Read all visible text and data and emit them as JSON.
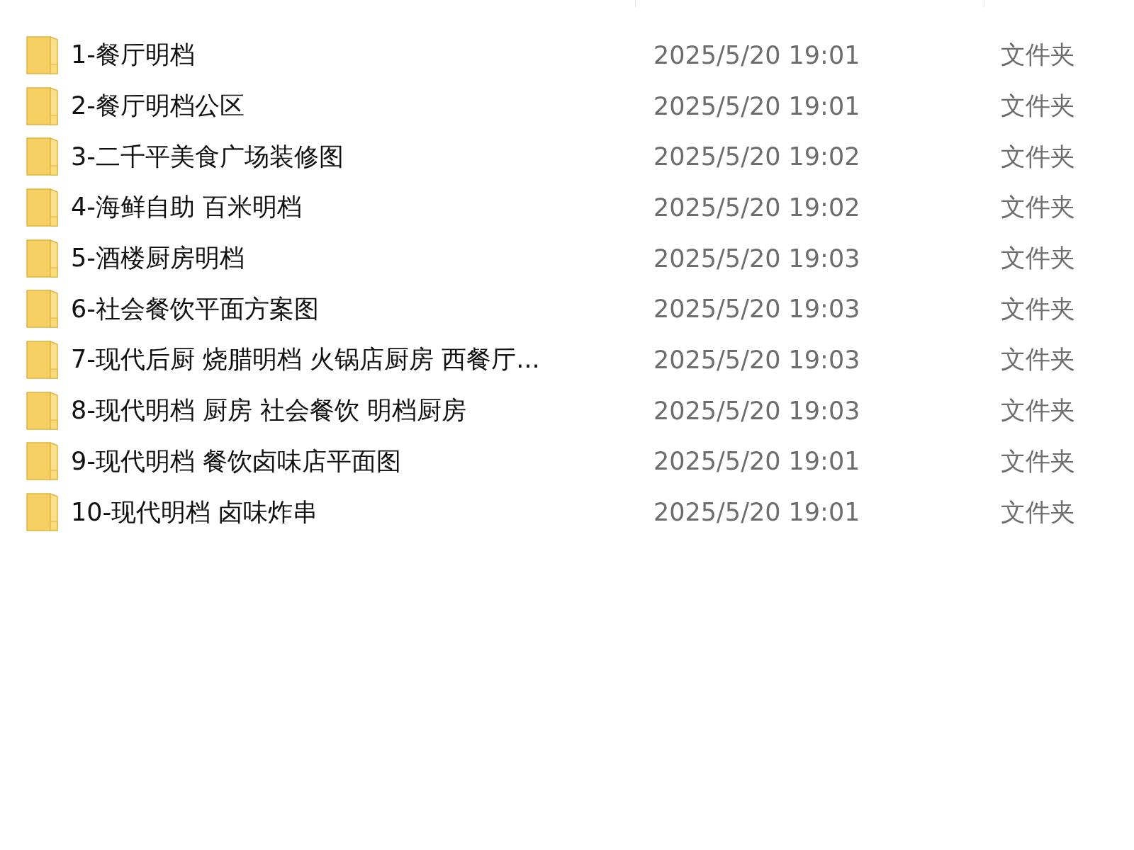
{
  "files": [
    {
      "name": "1-餐厅明档",
      "modified": "2025/5/20 19:01",
      "type": "文件夹"
    },
    {
      "name": "2-餐厅明档公区",
      "modified": "2025/5/20 19:01",
      "type": "文件夹"
    },
    {
      "name": "3-二千平美食广场装修图",
      "modified": "2025/5/20 19:02",
      "type": "文件夹"
    },
    {
      "name": "4-海鲜自助 百米明档",
      "modified": "2025/5/20 19:02",
      "type": "文件夹"
    },
    {
      "name": "5-酒楼厨房明档",
      "modified": "2025/5/20 19:03",
      "type": "文件夹"
    },
    {
      "name": "6-社会餐饮平面方案图",
      "modified": "2025/5/20 19:03",
      "type": "文件夹"
    },
    {
      "name": "7-现代后厨 烧腊明档 火锅店厨房 西餐厅...",
      "modified": "2025/5/20 19:03",
      "type": "文件夹"
    },
    {
      "name": "8-现代明档 厨房 社会餐饮 明档厨房",
      "modified": "2025/5/20 19:03",
      "type": "文件夹"
    },
    {
      "name": "9-现代明档 餐饮卤味店平面图",
      "modified": "2025/5/20 19:01",
      "type": "文件夹"
    },
    {
      "name": "10-现代明档 卤味炸串",
      "modified": "2025/5/20 19:01",
      "type": "文件夹"
    }
  ]
}
